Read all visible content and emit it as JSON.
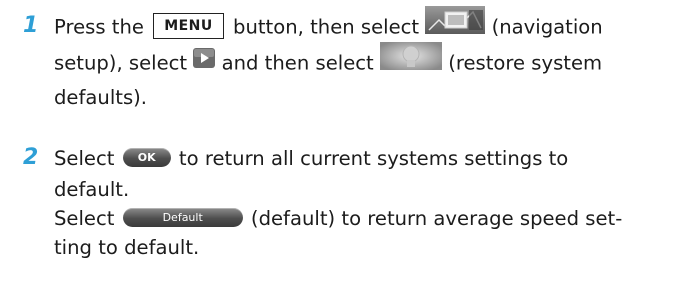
{
  "steps": [
    {
      "number": "1",
      "line1": {
        "before_key": "Press the",
        "key_label": "MENU",
        "after_key": "button, then select",
        "icon": "navigation-setup-icon",
        "after_icon": "(navigation"
      },
      "line2": {
        "before_arrow": "setup), select",
        "arrow_icon": "right-arrow-icon",
        "after_arrow": "and then select",
        "restore_icon": "restore-system-defaults-icon",
        "after_restore": "(restore system"
      },
      "line3": {
        "text": "defaults)."
      }
    },
    {
      "number": "2",
      "line1": {
        "before_ok": "Select",
        "ok_label": "OK",
        "after_ok": "to return all current systems settings to"
      },
      "line2": {
        "text": "default."
      },
      "line3": {
        "before_default": "Select",
        "default_label": "Default",
        "after_default": "(default) to return average speed set-"
      },
      "line4": {
        "text": "ting to default."
      }
    }
  ],
  "colors": {
    "step_number": "#2e9fd6",
    "text": "#1c1c1c"
  }
}
